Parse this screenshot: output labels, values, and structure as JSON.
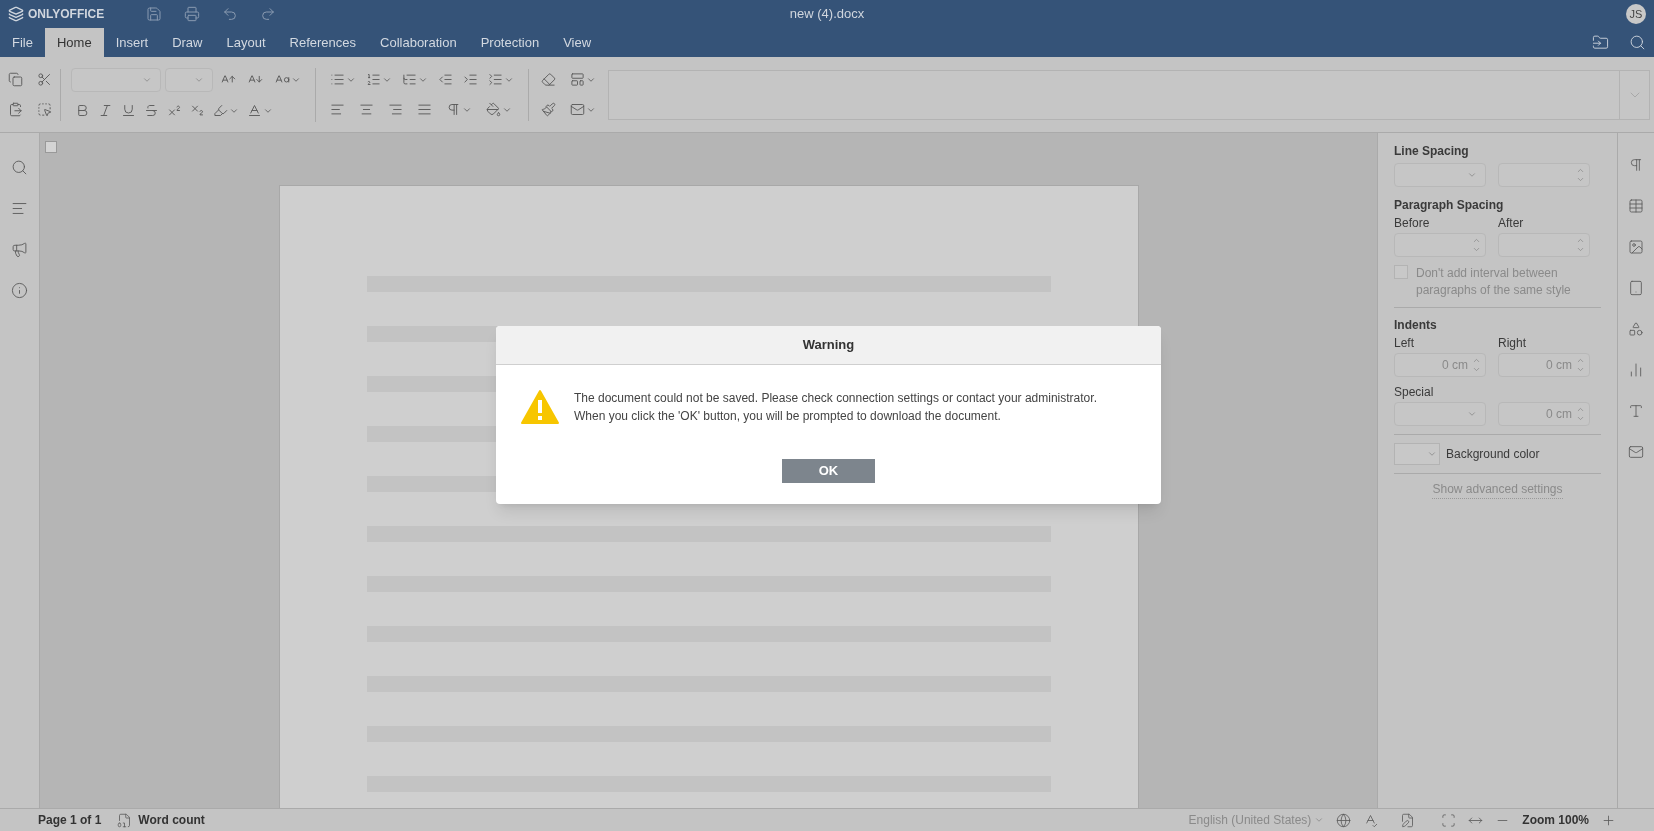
{
  "app": {
    "logo": "ONLYOFFICE",
    "title": "new (4).docx",
    "avatar": "JS"
  },
  "menu_tabs": [
    {
      "label": "File",
      "selected": false
    },
    {
      "label": "Home",
      "selected": true
    },
    {
      "label": "Insert",
      "selected": false
    },
    {
      "label": "Draw",
      "selected": false
    },
    {
      "label": "Layout",
      "selected": false
    },
    {
      "label": "References",
      "selected": false
    },
    {
      "label": "Collaboration",
      "selected": false
    },
    {
      "label": "Protection",
      "selected": false
    },
    {
      "label": "View",
      "selected": false
    }
  ],
  "right_panel": {
    "line_spacing": "Line Spacing",
    "paragraph_spacing": "Paragraph Spacing",
    "before": "Before",
    "after": "After",
    "no_interval": {
      "label": "Don't add interval between paragraphs of the same style",
      "checked": false
    },
    "indents": "Indents",
    "left": "Left",
    "right": "Right",
    "left_value": "0 cm",
    "right_value": "0 cm",
    "special": "Special",
    "special_value": "0 cm",
    "background_color": "Background color",
    "advanced": "Show advanced settings"
  },
  "status_bar": {
    "page": "Page 1 of 1",
    "word_count": "Word count",
    "language": "English (United States)",
    "zoom": "Zoom 100%"
  },
  "dialog": {
    "title": "Warning",
    "message": [
      "The document could not be saved. Please check connection settings or contact your administrator.",
      "When you click the 'OK' button, you will be prompted to download the document."
    ],
    "button": "OK"
  }
}
